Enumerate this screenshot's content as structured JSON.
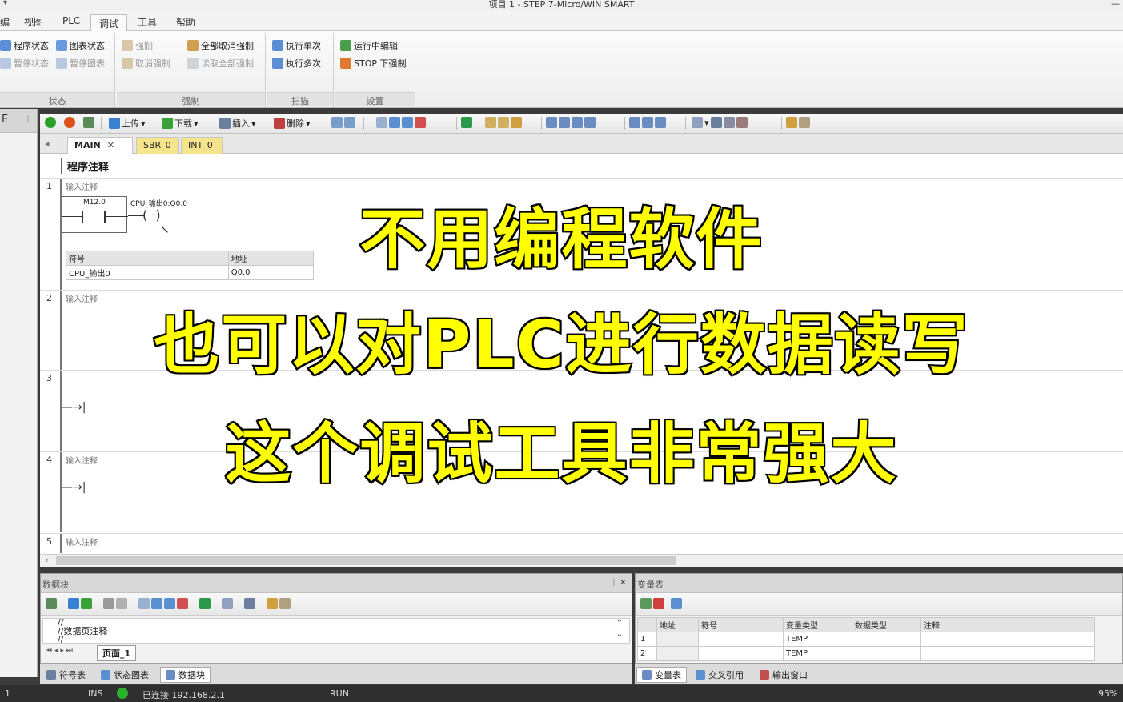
{
  "window": {
    "title": "项目 1 - STEP 7-Micro/WIN SMART",
    "quick_access": "▾"
  },
  "menu": {
    "tabs": [
      "视图",
      "PLC",
      "调试",
      "工具",
      "帮助"
    ],
    "active": "调试"
  },
  "ribbon": {
    "groups": {
      "status": {
        "name": "状态",
        "buttons": [
          "程序状态",
          "暂停状态",
          "图表状态",
          "暂停图表"
        ]
      },
      "force": {
        "name": "强制",
        "buttons": [
          "强制",
          "取消强制",
          "全部取消强制",
          "读取全部强制"
        ]
      },
      "scan": {
        "name": "扫描",
        "buttons": [
          "执行单次",
          "执行多次"
        ]
      },
      "settings": {
        "name": "设置",
        "buttons": [
          "运行中编辑",
          "STOP 下强制"
        ]
      }
    }
  },
  "editor_toolbar": {
    "upload": "上传",
    "download": "下载",
    "insert": "插入",
    "delete": "删除"
  },
  "pou_tabs": {
    "main": "MAIN",
    "sbr": "SBR_0",
    "int": "INT_0"
  },
  "editor": {
    "program_comment": "程序注释",
    "networks": [
      {
        "num": "1",
        "comment": "输入注释",
        "contact": "M12.0",
        "coil": "CPU_输出0:Q0.0"
      },
      {
        "num": "2",
        "comment": "输入注释"
      },
      {
        "num": "3",
        "comment": ""
      },
      {
        "num": "4",
        "comment": "输入注释"
      },
      {
        "num": "5",
        "comment": "输入注释"
      }
    ],
    "symbol_table": {
      "headers": [
        "符号",
        "地址"
      ],
      "rows": [
        [
          "CPU_输出0",
          "Q0.0"
        ]
      ]
    }
  },
  "overlay": {
    "line1": "不用编程软件",
    "line2": "也可以对PLC进行数据读写",
    "line3": "这个调试工具非常强大"
  },
  "datablock": {
    "title": "数据块",
    "pin": "ᛁ ✕",
    "line1": "//",
    "line2": "//数据页注释",
    "line3": "//",
    "page_tab": "页面_1"
  },
  "vartable": {
    "title": "变量表",
    "headers": [
      "",
      "地址",
      "符号",
      "变量类型",
      "数据类型",
      "注释"
    ],
    "rows": [
      [
        "1",
        "",
        "",
        "TEMP",
        "",
        ""
      ],
      [
        "2",
        "",
        "",
        "TEMP",
        "",
        ""
      ]
    ]
  },
  "bottom_tabs_left": [
    "符号表",
    "状态图表",
    "数据块"
  ],
  "bottom_tabs_right": [
    "变量表",
    "交叉引用",
    "输出窗口"
  ],
  "status": {
    "mode": "INS",
    "connection": "已连接 192.168.2.1",
    "plc_state": "RUN",
    "zoom": "95%",
    "row": "1"
  }
}
